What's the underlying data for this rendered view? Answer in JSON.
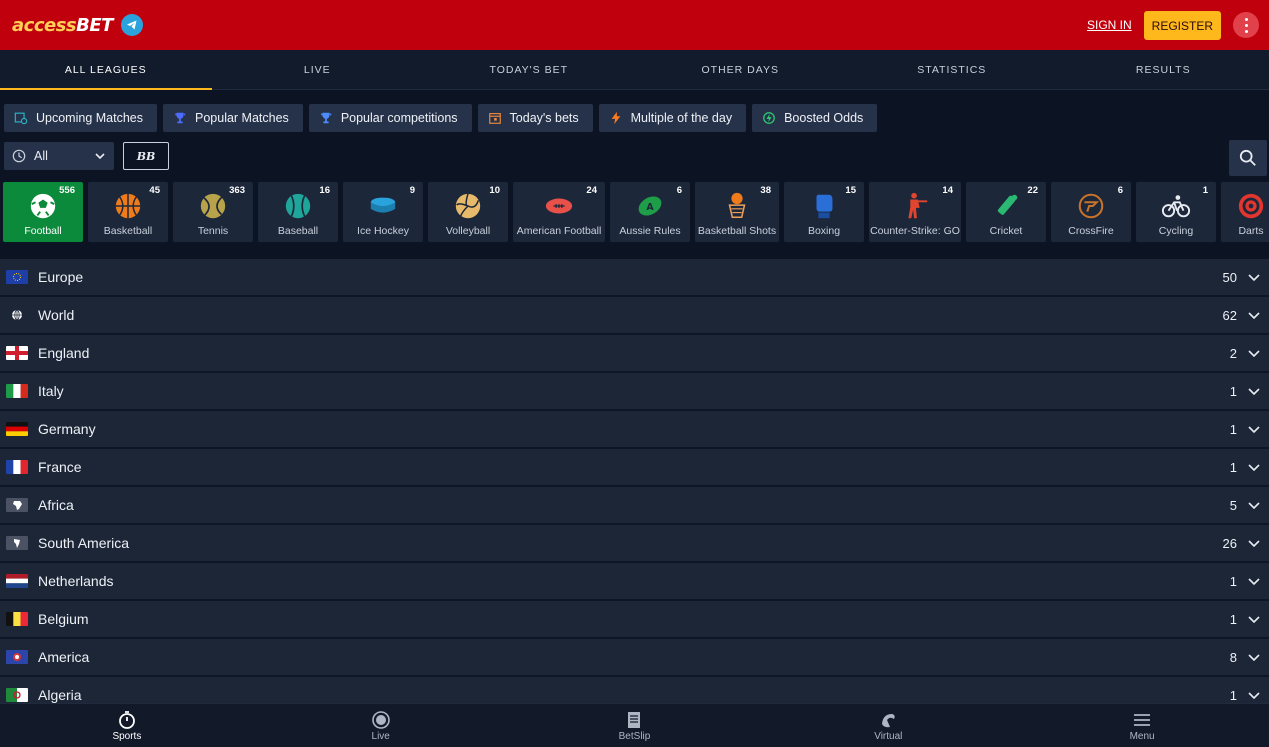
{
  "header": {
    "logo_main": "access",
    "logo_accent": "BET",
    "signin_label": "SIGN IN",
    "register_label": "REGISTER"
  },
  "nav_tabs": [
    "ALL LEAGUES",
    "LIVE",
    "TODAY'S BET",
    "OTHER DAYS",
    "STATISTICS",
    "RESULTS"
  ],
  "quick_filters": [
    "Upcoming Matches",
    "Popular Matches",
    "Popular competitions",
    "Today's bets",
    "Multiple of the day",
    "Boosted Odds"
  ],
  "time_filter": {
    "value": "All"
  },
  "bb_label": "BB",
  "sports": [
    {
      "name": "Football",
      "count": "556"
    },
    {
      "name": "Basketball",
      "count": "45"
    },
    {
      "name": "Tennis",
      "count": "363"
    },
    {
      "name": "Baseball",
      "count": "16"
    },
    {
      "name": "Ice Hockey",
      "count": "9"
    },
    {
      "name": "Volleyball",
      "count": "10"
    },
    {
      "name": "American Football",
      "count": "24"
    },
    {
      "name": "Aussie Rules",
      "count": "6"
    },
    {
      "name": "Basketball Shots",
      "count": "38"
    },
    {
      "name": "Boxing",
      "count": "15"
    },
    {
      "name": "Counter-Strike: GO",
      "count": "14"
    },
    {
      "name": "Cricket",
      "count": "22"
    },
    {
      "name": "CrossFire",
      "count": "6"
    },
    {
      "name": "Cycling",
      "count": "1"
    },
    {
      "name": "Darts",
      "count": ""
    }
  ],
  "leagues": [
    {
      "name": "Europe",
      "count": "50"
    },
    {
      "name": "World",
      "count": "62"
    },
    {
      "name": "England",
      "count": "2"
    },
    {
      "name": "Italy",
      "count": "1"
    },
    {
      "name": "Germany",
      "count": "1"
    },
    {
      "name": "France",
      "count": "1"
    },
    {
      "name": "Africa",
      "count": "5"
    },
    {
      "name": "South America",
      "count": "26"
    },
    {
      "name": "Netherlands",
      "count": "1"
    },
    {
      "name": "Belgium",
      "count": "1"
    },
    {
      "name": "America",
      "count": "8"
    },
    {
      "name": "Algeria",
      "count": "1"
    }
  ],
  "bottom_nav": [
    "Sports",
    "Live",
    "BetSlip",
    "Virtual",
    "Menu"
  ],
  "colors": {
    "header_red": "#c1000d",
    "accent_yellow": "#ffb81c",
    "active_green": "#0b8a3b"
  }
}
